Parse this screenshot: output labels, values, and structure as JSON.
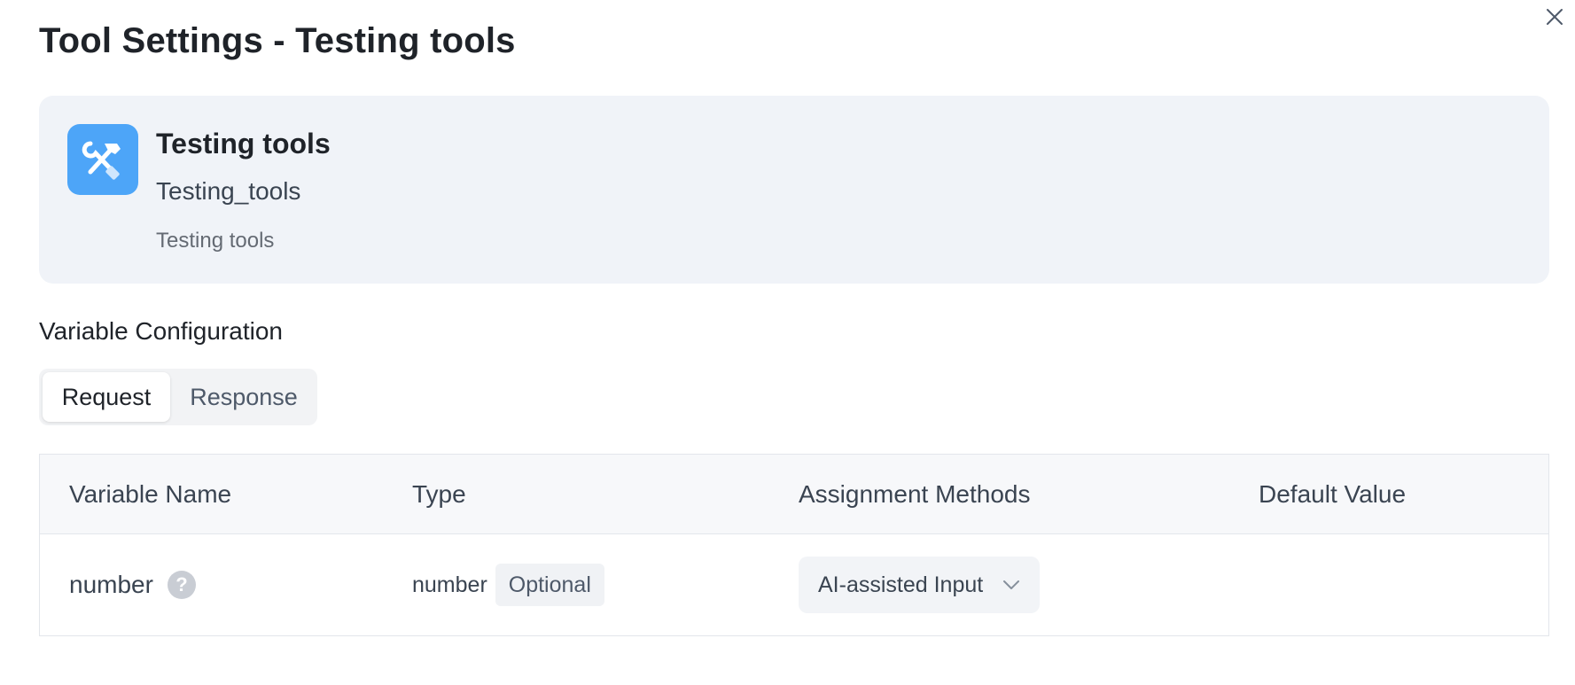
{
  "dialog": {
    "title": "Tool Settings - Testing tools"
  },
  "tool": {
    "name": "Testing tools",
    "id": "Testing_tools",
    "description": "Testing tools",
    "icon": "tools-hammer-wrench-icon",
    "icon_color": "#4da5f8"
  },
  "variable_config": {
    "label": "Variable Configuration",
    "tabs": [
      {
        "label": "Request",
        "active": true
      },
      {
        "label": "Response",
        "active": false
      }
    ]
  },
  "table": {
    "headers": [
      "Variable Name",
      "Type",
      "Assignment Methods",
      "Default Value"
    ],
    "rows": [
      {
        "name": "number",
        "type": "number",
        "badge": "Optional",
        "assignment": "AI-assisted Input",
        "default_value": ""
      }
    ]
  }
}
